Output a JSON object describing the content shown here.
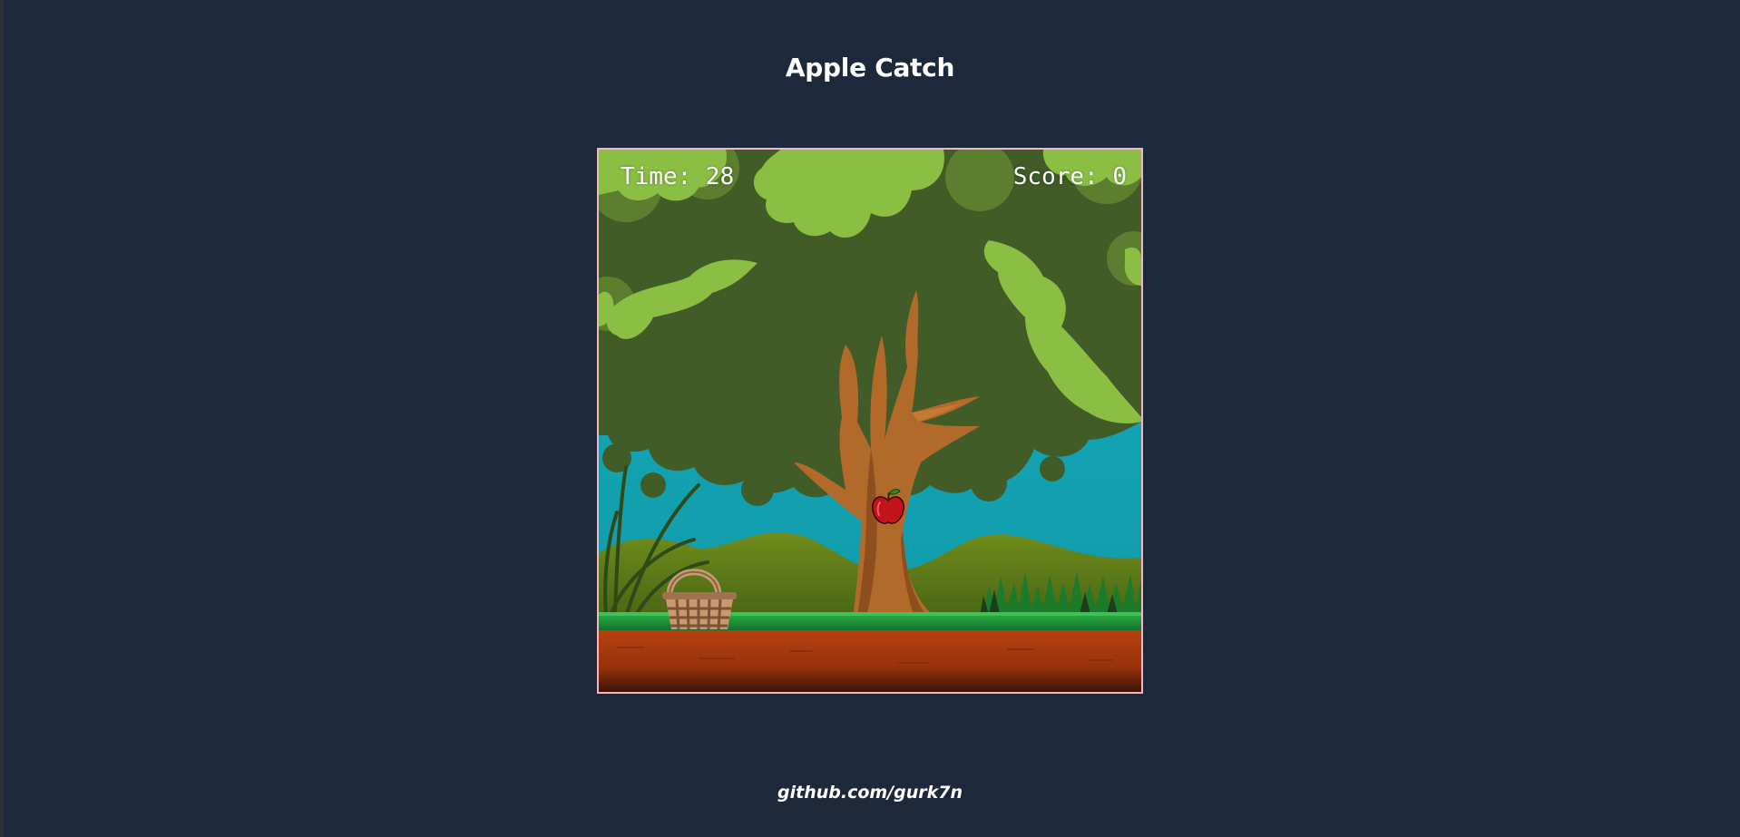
{
  "header": {
    "title": "Apple Catch"
  },
  "hud": {
    "time_text": "Time: 28",
    "score_text": "Score: 0"
  },
  "game": {
    "objects": [
      "apple-tree",
      "falling-apple",
      "basket",
      "grass-ground",
      "dirt-ground",
      "hills",
      "tall-grass"
    ]
  },
  "footer": {
    "link_text": "github.com/gurk7n"
  },
  "colors": {
    "page_background": "#1e283b",
    "sky": "#13a2b0",
    "frame_border": "#f2b6c2",
    "foliage_dark": "#415c27",
    "foliage_light": "#8abf44",
    "trunk": "#b16a2a",
    "apple": "#c0141a",
    "dirt": "#a8370e",
    "grass": "#1f9a3a"
  }
}
